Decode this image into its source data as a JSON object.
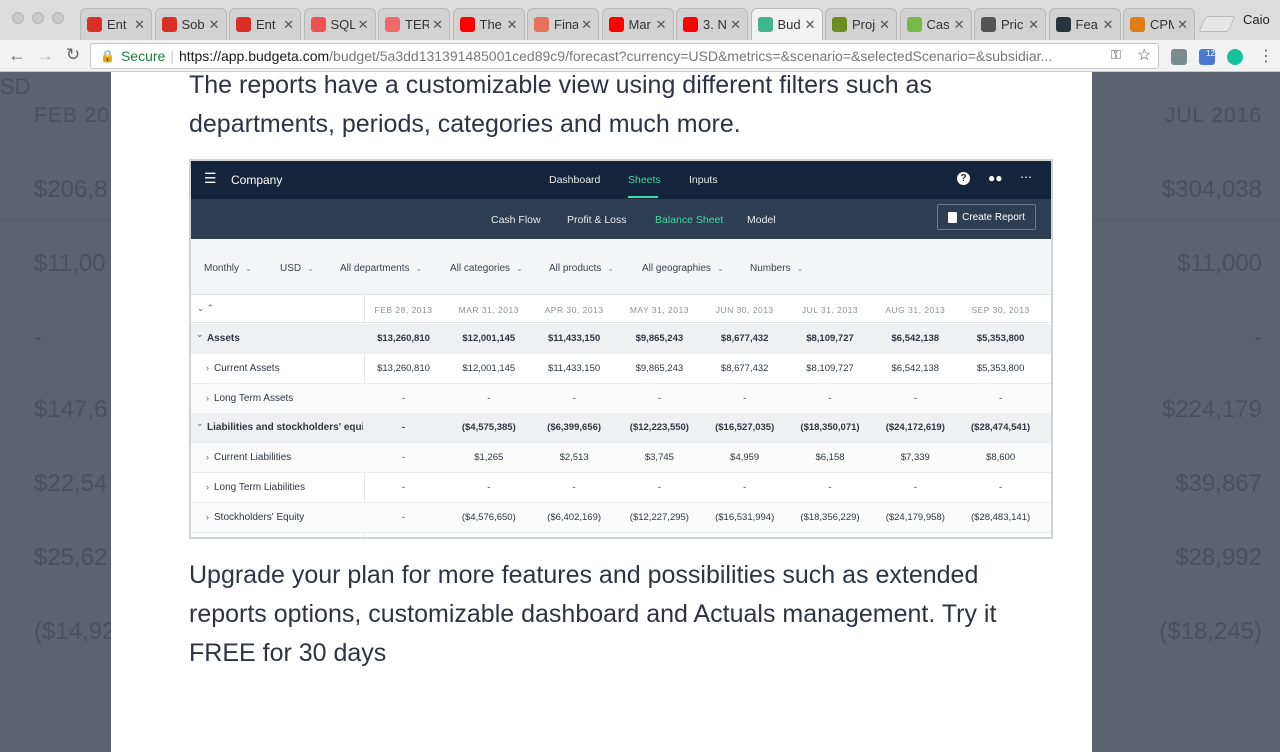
{
  "browser": {
    "tabs": [
      {
        "title": "Ent",
        "icon": "gmail-icon",
        "color": "#d93025"
      },
      {
        "title": "Sob",
        "icon": "gmail-icon",
        "color": "#d93025"
      },
      {
        "title": "Ent",
        "icon": "gmail-icon",
        "color": "#d93025"
      },
      {
        "title": "SQL",
        "icon": "udemy-icon",
        "color": "#ec5252"
      },
      {
        "title": "TER",
        "icon": "asana-icon",
        "color": "#f06a6a"
      },
      {
        "title": "The",
        "icon": "youtube-icon",
        "color": "#ff0000"
      },
      {
        "title": "Fina",
        "icon": "bookmark-icon",
        "color": "#e8735a"
      },
      {
        "title": "Mar",
        "icon": "youtube-icon",
        "color": "#ff0000"
      },
      {
        "title": "3. N",
        "icon": "youtube-icon",
        "color": "#ff0000"
      },
      {
        "title": "Bud",
        "icon": "budgeta-icon",
        "color": "#3fb58e"
      },
      {
        "title": "Proj",
        "icon": "chart-icon",
        "color": "#6b8e23"
      },
      {
        "title": "Cas",
        "icon": "chart-icon",
        "color": "#76b947"
      },
      {
        "title": "Pric",
        "icon": "chart-icon",
        "color": "#555555"
      },
      {
        "title": "Fea",
        "icon": "fs-icon",
        "color": "#2b3340"
      },
      {
        "title": "CPM",
        "icon": "cpm-icon",
        "color": "#e07b1a"
      }
    ],
    "profile": "Caio",
    "url": {
      "secure_label": "Secure",
      "host": "https://app.budgeta.com",
      "path": "/budget/5a3dd131391485001ced89c9/forecast?currency=USD&metrics=&scenario=&selectedScenario=&subsidiar..."
    },
    "extension_badge": "12"
  },
  "background": {
    "top_left": "SD",
    "col_left": [
      "FEB 20",
      "$206,8",
      "$11,00",
      "-",
      "$147,6",
      "$22,54",
      "$25,62",
      "($14,92"
    ],
    "col_right": [
      "JUL 2016",
      "$304,038",
      "$11,000",
      "-",
      "$224,179",
      "$39,867",
      "$28,992",
      "($18,245)"
    ]
  },
  "modal": {
    "intro": "The reports have a customizable view using different filters such as departments, periods, categories and much more.",
    "outro": "Upgrade your plan for more features and possibilities such as extended reports options, customizable dashboard and Actuals management. Try it FREE for 30 days",
    "screenshot": {
      "company": "Company",
      "nav": [
        "Dashboard",
        "Sheets",
        "Inputs"
      ],
      "subnav": [
        "Cash Flow",
        "Profit & Loss",
        "Balance Sheet",
        "Model"
      ],
      "create_report": "Create Report",
      "filters": [
        "Monthly",
        "USD",
        "All departments",
        "All categories",
        "All products",
        "All geographies",
        "Numbers"
      ],
      "columns": [
        "FEB 28, 2013",
        "MAR 31, 2013",
        "APR 30, 2013",
        "MAY 31, 2013",
        "JUN 30, 2013",
        "JUL 31, 2013",
        "AUG 31, 2013",
        "SEP 30, 2013"
      ],
      "rows": [
        {
          "label": "Assets",
          "values": [
            "$13,260,810",
            "$12,001,145",
            "$11,433,150",
            "$9,865,243",
            "$8,677,432",
            "$8,109,727",
            "$6,542,138",
            "$5,353,800"
          ]
        },
        {
          "label": "Current Assets",
          "values": [
            "$13,260,810",
            "$12,001,145",
            "$11,433,150",
            "$9,865,243",
            "$8,677,432",
            "$8,109,727",
            "$6,542,138",
            "$5,353,800"
          ]
        },
        {
          "label": "Long Term Assets",
          "values": [
            "-",
            "-",
            "-",
            "-",
            "-",
            "-",
            "-",
            "-"
          ]
        },
        {
          "label": "Liabilities and stockholders' equi...",
          "values": [
            "-",
            "($4,575,385)",
            "($6,399,656)",
            "($12,223,550)",
            "($16,527,035)",
            "($18,350,071)",
            "($24,172,619)",
            "($28,474,541)"
          ]
        },
        {
          "label": "Current Liabilities",
          "values": [
            "-",
            "$1,265",
            "$2,513",
            "$3,745",
            "$4,959",
            "$6,158",
            "$7,339",
            "$8,600"
          ]
        },
        {
          "label": "Long Term Liabilities",
          "values": [
            "-",
            "-",
            "-",
            "-",
            "-",
            "-",
            "-",
            "-"
          ]
        },
        {
          "label": "Stockholders' Equity",
          "values": [
            "-",
            "($4,576,650)",
            "($6,402,169)",
            "($12,227,295)",
            "($16,531,994)",
            "($18,356,229)",
            "($24,179,958)",
            "($28,483,141)"
          ]
        }
      ]
    }
  }
}
